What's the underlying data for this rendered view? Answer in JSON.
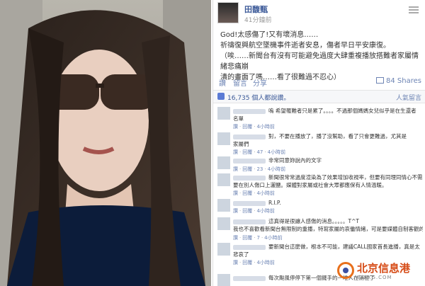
{
  "post": {
    "author": "田馥甄",
    "time": "41分鐘前",
    "lines": [
      "God!太感傷了!又有壞消息……",
      "祈禱復興航空墜機事件逝者安息，傷者早日平安康復。",
      "（唉……新聞台有沒有可能避免過度大肆重複播放搭難者家屬情緒悲痛崩",
      "潰的畫面了嗎……看了很難過不忍心）"
    ],
    "actions": [
      "讚",
      "留言",
      "分享"
    ],
    "shares": "84 Shares"
  },
  "likes": {
    "text": "16,735 個人都說讚。",
    "sort": "人氣留言"
  },
  "comments": [
    {
      "text": "嗚 希望罹難者只是累了。。。。不過那個媽媽女兒似乎是在生還者",
      "text2": "名單",
      "meta": [
        "讚",
        "回覆",
        "4小時前"
      ]
    },
    {
      "text": "對，不要在播放了，播了沒幫助，看了只會更難過，尤其是",
      "text2": "家屬們",
      "meta": [
        "讚",
        "回覆",
        "47",
        "4小時前"
      ]
    },
    {
      "text": "非常同意妳說內的文字",
      "text2": "",
      "meta": [
        "讚",
        "回覆",
        "23",
        "4小時前"
      ]
    },
    {
      "text": "新聞很常常過度渲染為了效果增加收視率，但要有同理同情心不需",
      "text2": "要在別人傷口上灑鹽。媒體對家屬或社會大眾都應保有人情溫暖。",
      "meta": [
        "讚",
        "回覆",
        "4小時前"
      ]
    },
    {
      "text": "R.I.P.",
      "text2": "",
      "meta": [
        "讚",
        "回覆",
        "4小時前"
      ]
    },
    {
      "text": "這真得是很讓人感傷的消息。。。。。T^T",
      "text2": "我也不喜歡看新聞台無限制的重播，特寫家屬的哀働情緒，可是要媒體自制客觀的去播報新聞好像有點難",
      "meta": [
        "讚",
        "回覆",
        "7",
        "4小時前"
      ]
    },
    {
      "text": "要新聞台這麼做，根本不可能，建議CALL國家首長進播，真是太",
      "text2": "悲哀了",
      "meta": [
        "讚",
        "回覆",
        "4小時前"
      ]
    },
    {
      "text": "每次颱風停停下第一個擺手的一堆人在消極了",
      "text2": "",
      "meta": []
    }
  ],
  "watermark": {
    "text": "北京信息港",
    "url": "BJXXG.COM"
  }
}
